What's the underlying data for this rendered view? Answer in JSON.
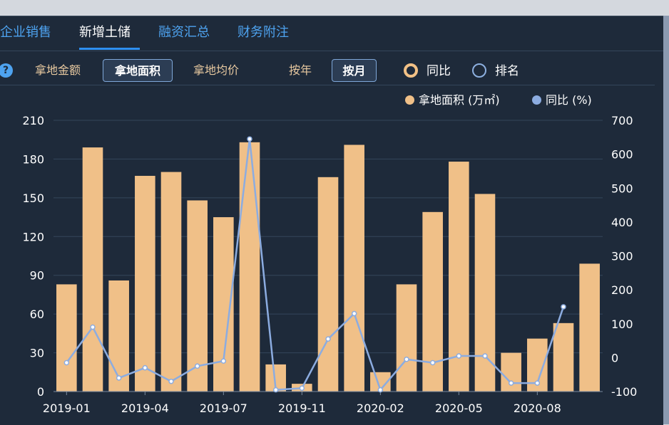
{
  "tabs": [
    {
      "label": "企业销售",
      "active": false
    },
    {
      "label": "新增土储",
      "active": true
    },
    {
      "label": "融资汇总",
      "active": false
    },
    {
      "label": "财务附注",
      "active": false
    }
  ],
  "filters": {
    "metrics": [
      "拿地金额",
      "拿地面积",
      "拿地均价"
    ],
    "selected_metric": "拿地面积",
    "periods": [
      "按年",
      "按月"
    ],
    "selected_period": "按月",
    "radio_options": [
      "同比",
      "排名"
    ],
    "selected_radio": "同比"
  },
  "colors": {
    "bar": "#f0c088",
    "line": "#8cace0",
    "tab_active": "#ffffff",
    "tab": "#4ea3f0"
  },
  "chart_data": {
    "type": "bar",
    "legend": [
      {
        "label": "拿地面积 (万㎡)",
        "color": "#f0c088"
      },
      {
        "label": "同比 (%)",
        "color": "#8cace0"
      }
    ],
    "x_ticks": [
      "2019-01",
      "2019-04",
      "2019-07",
      "2019-11",
      "2020-02",
      "2020-05",
      "2020-08"
    ],
    "x_tick_indices": [
      0,
      3,
      6,
      9,
      12,
      15,
      18
    ],
    "y_left": {
      "min": 0,
      "max": 210,
      "ticks": [
        0,
        30,
        60,
        90,
        120,
        150,
        180,
        210
      ]
    },
    "y_right": {
      "min": -100,
      "max": 700,
      "ticks": [
        -100,
        0,
        100,
        200,
        300,
        400,
        500,
        600,
        700
      ]
    },
    "series": [
      {
        "name": "拿地面积 (万㎡)",
        "type": "bar",
        "axis": "left",
        "values": [
          83,
          189,
          86,
          167,
          170,
          148,
          135,
          193,
          21,
          6,
          166,
          191,
          15,
          83,
          139,
          178,
          153,
          30,
          41,
          53,
          99
        ]
      },
      {
        "name": "同比 (%)",
        "type": "line",
        "axis": "right",
        "values": [
          -15,
          90,
          -60,
          -30,
          -70,
          -25,
          -10,
          645,
          -95,
          -90,
          55,
          130,
          -95,
          -5,
          -15,
          5,
          5,
          -75,
          -75,
          150
        ]
      }
    ],
    "grid": true
  }
}
